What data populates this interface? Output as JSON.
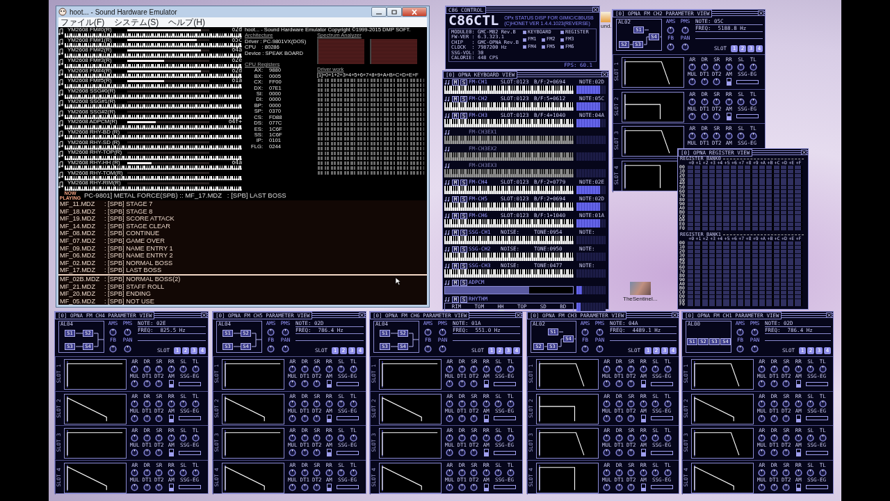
{
  "hoot": {
    "title": "hoot... - Sound Hardware Emulator",
    "menu": [
      {
        "label": "ファイル(F)"
      },
      {
        "label": "システム(S)"
      },
      {
        "label": "ヘルプ(H)"
      }
    ],
    "channels": [
      {
        "label": "YM2608 FM#0(R)",
        "note": "o2d",
        "level": 0.9
      },
      {
        "label": "YM2608 FM#1(R)",
        "note": "o5c",
        "level": 0.85
      },
      {
        "label": "YM2608 FM#2(R)",
        "note": "o4a",
        "level": 0.9
      },
      {
        "label": "YM2608 FM#3(R)",
        "note": "o2e",
        "level": 0.45
      },
      {
        "label": "YM2608 FM#4(R)",
        "note": "o2d",
        "level": 0.9
      },
      {
        "label": "YM2608 FM#5(R)",
        "note": "o1a",
        "level": 0.45
      },
      {
        "label": "YM2608 SSG#0(R)",
        "level": 0
      },
      {
        "label": "YM2608 SSG#1(R)",
        "level": 0
      },
      {
        "label": "YM2608 SSG#2(R)",
        "level": 0
      },
      {
        "label": "YM2608 ADPCM(R)",
        "note": "o4f+",
        "level": 0.35
      },
      {
        "label": "YM2608 RHY-BD (R)",
        "level": 0
      },
      {
        "label": "YM2608 RHY-SD (R)",
        "level": 0
      },
      {
        "label": "YM2608 RHY-TOP(R)",
        "level": 0
      },
      {
        "label": "YM2608 RHY-HH (R)",
        "note": "o4a",
        "level": 0.3
      },
      {
        "label": "YM2608 RHY-TOM(R)",
        "level": 0
      },
      {
        "label": "YM2608 RHY-RIM(R)",
        "level": 0
      }
    ],
    "copyright": "hoot... - Sound Hardware Emulator Copyright ©1999-2015 DMP SOFT.",
    "architecture": {
      "heading": "Architecture",
      "lines": [
        "Driver : PC-9801VX(DOS)",
        "CPU    : 80286",
        "Device : SPEAK BOARD"
      ]
    },
    "registers": {
      "heading": "CPU Registers",
      "items": [
        {
          "name": "AX:",
          "value": "9880"
        },
        {
          "name": "BX:",
          "value": "0005"
        },
        {
          "name": "CX:",
          "value": "FF00"
        },
        {
          "name": "DX:",
          "value": "07E1"
        },
        {
          "name": "SI:",
          "value": "0000"
        },
        {
          "name": "DI:",
          "value": "0000"
        },
        {
          "name": "BP:",
          "value": "0000"
        },
        {
          "name": "SP:",
          "value": "0370"
        },
        {
          "name": "CS:",
          "value": "FD88"
        },
        {
          "name": "DS:",
          "value": "077C"
        },
        {
          "name": "ES:",
          "value": "1C6F"
        },
        {
          "name": "SS:",
          "value": "1C6F"
        },
        {
          "name": "IP:",
          "value": "0101"
        },
        {
          "name": "FLG:",
          "value": "0244"
        }
      ]
    },
    "spectrum": {
      "heading": "Spectrum Analyzer"
    },
    "driver_work": {
      "heading": "Driver work",
      "header": "[1]+0+1+2+3+4+5+6+7+8+9+A+B+C+D+E+F"
    },
    "playlist": {
      "now_playing": "NOW PLAYING",
      "header": "PC-9801] METAL FORCE(SPB) :: MF_17.MDZ   : [SPB] LAST BOSS",
      "items": [
        {
          "file": "MF_11.MDZ",
          "title": ": [SPB] STAGE 7",
          "selected": false
        },
        {
          "file": "MF_18.MDZ",
          "title": ": [SPB] STAGE 8",
          "selected": false
        },
        {
          "file": "MF_19.MDZ",
          "title": ": [SPB] SCORE ATTACK",
          "selected": false
        },
        {
          "file": "MF_14.MDZ",
          "title": ": [SPB] STAGE CLEAR",
          "selected": false
        },
        {
          "file": "MF_08.MDZ",
          "title": ": [SPB] CONTINUE",
          "selected": false
        },
        {
          "file": "MF_07.MDZ",
          "title": ": [SPB] GAME OVER",
          "selected": false
        },
        {
          "file": "MF_09.MDZ",
          "title": ": [SPB] NAME ENTRY 1",
          "selected": false
        },
        {
          "file": "MF_06.MDZ",
          "title": ": [SPB] NAME ENTRY 2",
          "selected": false
        },
        {
          "file": "MF_02.MDZ",
          "title": ": [SPB] NORMAL BOSS",
          "selected": false
        },
        {
          "file": "MF_17.MDZ",
          "title": ": [SPB] LAST BOSS",
          "selected": true
        },
        {
          "file": "MF_02B.MDZ",
          "title": ": [SPB] NORMAL BOSS(2)",
          "selected": false
        },
        {
          "file": "MF_21.MDZ",
          "title": ": [SPB] STAFF ROLL",
          "selected": false
        },
        {
          "file": "MF_20.MDZ",
          "title": ": [SPB] ENDING",
          "selected": false
        },
        {
          "file": "MF_05.MDZ",
          "title": ": [SPB] NOT USE",
          "selected": false
        }
      ]
    }
  },
  "c86_control": {
    "title": "C86 CONTROL",
    "logo": "C86CTL",
    "subtitle": [
      "OPx STATUS DISP FOR GIMIC/C86USB",
      "(C)HONET VER 1.4.4.1023(REVERSE)"
    ],
    "info": [
      "MODULE0: GMC-MB2 Rev.B",
      "FW-VER : 6.3.323.1",
      "CHIP   : GMC-OPNA Rev.B",
      "CLOCK  : 7987200 Hz",
      "SSG-VOL: 30",
      "CALORIE: 448 CPS"
    ],
    "options": [
      {
        "label": "KEYBOARD",
        "checked": true
      },
      {
        "label": "REGISTER",
        "checked": true
      },
      {
        "label": "FM1",
        "checked": true
      },
      {
        "label": "FM2",
        "checked": true
      },
      {
        "label": "FM3",
        "checked": true
      },
      {
        "label": "FM4",
        "checked": true
      },
      {
        "label": "FM5",
        "checked": true
      },
      {
        "label": "FM6",
        "checked": true
      }
    ],
    "fps": "FPS: 60.1"
  },
  "keyboard_view": {
    "title": "[0] OPNA KEYBOARD VIEW",
    "rows": [
      {
        "kind": "fm",
        "name": "FM-CH1",
        "mute": "M",
        "solo": "S",
        "field1": "SLOT:0123",
        "field2": "B/F:2+0694",
        "note": "NOTE:02D",
        "meter": {
          "level": 0.8
        }
      },
      {
        "kind": "fm",
        "name": "FM-CH2",
        "mute": "M",
        "solo": "S",
        "field1": "SLOT:0123",
        "field2": "B/F:5+0612",
        "note": "NOTE:05C",
        "meter": {
          "level": 0.8
        }
      },
      {
        "kind": "fm",
        "name": "FM-CH3",
        "mute": "M",
        "solo": "S",
        "field1": "SLOT:0123",
        "field2": "B/F:4+1040",
        "note": "NOTE:04A",
        "meter": {
          "level": 0.8
        }
      },
      {
        "kind": "ex",
        "name": "FM-CH3EX1",
        "meter": {
          "level": 0
        }
      },
      {
        "kind": "ex",
        "name": "FM-CH3EX2",
        "meter": {
          "level": 0
        }
      },
      {
        "kind": "ex",
        "name": "FM-CH3EX3",
        "meter": {
          "level": 0
        }
      },
      {
        "kind": "fm",
        "name": "FM-CH4",
        "mute": "M",
        "solo": "S",
        "field1": "SLOT:0123",
        "field2": "B/F:2+0779",
        "note": "NOTE:02E",
        "meter": {
          "level": 0.8
        }
      },
      {
        "kind": "fm",
        "name": "FM-CH5",
        "mute": "M",
        "solo": "S",
        "field1": "SLOT:0123",
        "field2": "B/F:2+0694",
        "note": "NOTE:02D",
        "meter": {
          "level": 0.8
        }
      },
      {
        "kind": "fm",
        "name": "FM-CH6",
        "mute": "M",
        "solo": "S",
        "field1": "SLOT:0123",
        "field2": "B/F:1+1040",
        "note": "NOTE:01A",
        "meter": {
          "level": 0.8
        }
      },
      {
        "kind": "ssg",
        "name": "SSG-CH1",
        "mute": "M",
        "solo": "S",
        "field1": "NOISE:",
        "field2": "TONE:0954",
        "note": "NOTE:",
        "meter": {
          "level": 0
        }
      },
      {
        "kind": "ssg",
        "name": "SSG-CH2",
        "mute": "M",
        "solo": "S",
        "field1": "NOISE:",
        "field2": "TONE:0950",
        "note": "NOTE:",
        "meter": {
          "level": 0
        }
      },
      {
        "kind": "ssg",
        "name": "SSG-CH3",
        "mute": "M",
        "solo": "S",
        "field1": "NOISE:",
        "field2": "TONE:0477",
        "note": "NOTE:",
        "meter": {
          "level": 0
        }
      },
      {
        "kind": "adpcm",
        "name": "ADPCM",
        "mute": "M",
        "solo": "S",
        "bar": {
          "level": 0.66
        },
        "meter": {
          "level": 0.2
        }
      },
      {
        "kind": "rhythm",
        "name": "RHYTHM",
        "mute": "M",
        "solo": "S",
        "drums": [
          {
            "label": "RIM",
            "on": false
          },
          {
            "label": "TOM",
            "on": false
          },
          {
            "label": "HH",
            "on": true
          },
          {
            "label": "TOP",
            "on": false
          },
          {
            "label": "SD",
            "on": false
          },
          {
            "label": "BD",
            "on": false
          }
        ],
        "meter": {
          "level": 0.15
        }
      }
    ]
  },
  "param_views": [
    {
      "title": "[0] OPNA FM CH2 PARAMETER VIEW",
      "algorithm": {
        "kind": "alg2",
        "label": "AL02",
        "ops": [
          "S1",
          "S2",
          "S3",
          "S4"
        ]
      },
      "top_knobs": [
        "AMS",
        "PMS",
        "FB",
        "PAN"
      ],
      "note": "NOTE: 05C",
      "freq_label": "FREQ:",
      "freq": "5188.8 Hz",
      "slot_label": "SLOT",
      "slot_buttons": [
        {
          "label": "1",
          "on": true
        },
        {
          "label": "2",
          "on": true
        },
        {
          "label": "3",
          "on": true
        },
        {
          "label": "4",
          "on": true
        }
      ],
      "slot_panels": [
        {
          "label": "SLOT 1",
          "envelope": {
            "kind": "drop"
          },
          "knobs": [
            "AR",
            "DR",
            "SR",
            "RR",
            "SL",
            "TL"
          ],
          "knobs2": [
            "MUL",
            "DT1",
            "DT2"
          ],
          "am_label": "AM",
          "am": {
            "on": true
          },
          "ssg": "SSG-EG"
        },
        {
          "label": "SLOT 2",
          "envelope": {
            "kind": "step"
          },
          "knobs": [
            "AR",
            "DR",
            "SR",
            "RR",
            "SL",
            "TL"
          ],
          "knobs2": [
            "MUL",
            "DT1",
            "DT2"
          ],
          "am_label": "AM",
          "am": {
            "on": true
          },
          "ssg": "SSG-EG"
        },
        {
          "label": "SLOT 3",
          "envelope": {
            "kind": "drop"
          },
          "knobs": [
            "AR",
            "DR",
            "SR",
            "RR",
            "SL",
            "TL"
          ],
          "knobs2": [
            "MUL",
            "DT1",
            "DT2"
          ],
          "am_label": "AM",
          "ssg": "SSG-EG"
        },
        {
          "label": "SLOT 4",
          "envelope": {
            "kind": "highstep"
          }
        }
      ]
    },
    {
      "title": "[0] OPNA FM CH4 PARAMETER VIEW",
      "algorithm": {
        "kind": "alg4",
        "label": "AL04",
        "ops": [
          "S1",
          "S2",
          "S3",
          "S4"
        ]
      },
      "top_knobs": [
        "AMS",
        "PMS",
        "FB",
        "PAN"
      ],
      "note": "NOTE: 02E",
      "freq_label": "FREQ:",
      "freq": "825.5 Hz",
      "slot_label": "SLOT",
      "slot_buttons": [
        {
          "label": "1",
          "on": true
        },
        {
          "label": "2",
          "on": true
        },
        {
          "label": "3",
          "on": true
        },
        {
          "label": "4",
          "on": true
        }
      ],
      "slot_panels": [
        {
          "label": "SLOT 1",
          "envelope": {
            "kind": "flat"
          },
          "knobs": [
            "AR",
            "DR",
            "SR",
            "RR",
            "SL",
            "TL"
          ],
          "knobs2": [
            "MUL",
            "DT1",
            "DT2"
          ],
          "am_label": "AM",
          "am": {
            "on": true
          },
          "ssg": "SSG-EG"
        },
        {
          "label": "SLOT 2",
          "envelope": {
            "kind": "ramp"
          },
          "knobs": [
            "AR",
            "DR",
            "SR",
            "RR",
            "SL",
            "TL"
          ],
          "knobs2": [
            "MUL",
            "DT1",
            "DT2"
          ],
          "am_label": "AM",
          "am": {
            "on": true
          },
          "ssg": "SSG-EG"
        },
        {
          "label": "SLOT 3",
          "envelope": {
            "kind": "flat"
          },
          "knobs": [
            "AR",
            "DR",
            "SR",
            "RR",
            "SL",
            "TL"
          ],
          "knobs2": [
            "MUL",
            "DT1",
            "DT2"
          ],
          "am_label": "AM",
          "am": {
            "on": true
          },
          "ssg": "SSG-EG"
        },
        {
          "label": "SLOT 4",
          "envelope": {
            "kind": "ramp"
          },
          "knobs": [
            "AR",
            "DR",
            "SR",
            "RR",
            "SL",
            "TL"
          ],
          "knobs2": [
            "MUL",
            "DT1",
            "DT2"
          ],
          "am_label": "AM",
          "am": {
            "on": true
          },
          "ssg": "SSG-EG"
        }
      ]
    },
    {
      "title": "[0] OPNA FM CH5 PARAMETER VIEW",
      "algorithm": {
        "kind": "alg4",
        "label": "AL04",
        "ops": [
          "S1",
          "S2",
          "S3",
          "S4"
        ]
      },
      "top_knobs": [
        "AMS",
        "PMS",
        "FB",
        "PAN"
      ],
      "note": "NOTE: 02D",
      "freq_label": "FREQ:",
      "freq": "786.4 Hz",
      "slot_label": "SLOT",
      "slot_buttons": [
        {
          "label": "1",
          "on": true
        },
        {
          "label": "2",
          "on": true
        },
        {
          "label": "3",
          "on": true
        },
        {
          "label": "4",
          "on": true
        }
      ],
      "slot_panels": [
        {
          "label": "SLOT 1",
          "envelope": {
            "kind": "flat"
          },
          "knobs": [
            "AR",
            "DR",
            "SR",
            "RR",
            "SL",
            "TL"
          ],
          "knobs2": [
            "MUL",
            "DT1",
            "DT2"
          ],
          "am_label": "AM",
          "am": {
            "on": true
          },
          "ssg": "SSG-EG"
        },
        {
          "label": "SLOT 2",
          "envelope": {
            "kind": "ramp"
          },
          "knobs": [
            "AR",
            "DR",
            "SR",
            "RR",
            "SL",
            "TL"
          ],
          "knobs2": [
            "MUL",
            "DT1",
            "DT2"
          ],
          "am_label": "AM",
          "am": {
            "on": true
          },
          "ssg": "SSG-EG"
        },
        {
          "label": "SLOT 3",
          "envelope": {
            "kind": "flat"
          },
          "knobs": [
            "AR",
            "DR",
            "SR",
            "RR",
            "SL",
            "TL"
          ],
          "knobs2": [
            "MUL",
            "DT1",
            "DT2"
          ],
          "am_label": "AM",
          "am": {
            "on": true
          },
          "ssg": "SSG-EG"
        },
        {
          "label": "SLOT 4",
          "envelope": {
            "kind": "ramp"
          },
          "knobs": [
            "AR",
            "DR",
            "SR",
            "RR",
            "SL",
            "TL"
          ],
          "knobs2": [
            "MUL",
            "DT1",
            "DT2"
          ],
          "am_label": "AM",
          "am": {
            "on": true
          },
          "ssg": "SSG-EG"
        }
      ]
    },
    {
      "title": "[0] OPNA FM CH6 PARAMETER VIEW",
      "algorithm": {
        "kind": "alg4",
        "label": "AL04",
        "ops": [
          "S1",
          "S2",
          "S3",
          "S4"
        ]
      },
      "top_knobs": [
        "AMS",
        "PMS",
        "FB",
        "PAN"
      ],
      "note": "NOTE: 01A",
      "freq_label": "FREQ:",
      "freq": "551.0 Hz",
      "slot_label": "SLOT",
      "slot_buttons": [
        {
          "label": "1",
          "on": true
        },
        {
          "label": "2",
          "on": true
        },
        {
          "label": "3",
          "on": true
        },
        {
          "label": "4",
          "on": true
        }
      ],
      "slot_panels": [
        {
          "label": "SLOT 1",
          "envelope": {
            "kind": "flat"
          },
          "knobs": [
            "AR",
            "DR",
            "SR",
            "RR",
            "SL",
            "TL"
          ],
          "knobs2": [
            "MUL",
            "DT1",
            "DT2"
          ],
          "am_label": "AM",
          "am": {
            "on": true
          },
          "ssg": "SSG-EG"
        },
        {
          "label": "SLOT 2",
          "envelope": {
            "kind": "ramp"
          },
          "knobs": [
            "AR",
            "DR",
            "SR",
            "RR",
            "SL",
            "TL"
          ],
          "knobs2": [
            "MUL",
            "DT1",
            "DT2"
          ],
          "am_label": "AM",
          "am": {
            "on": true
          },
          "ssg": "SSG-EG"
        },
        {
          "label": "SLOT 3",
          "envelope": {
            "kind": "flat"
          },
          "knobs": [
            "AR",
            "DR",
            "SR",
            "RR",
            "SL",
            "TL"
          ],
          "knobs2": [
            "MUL",
            "DT1",
            "DT2"
          ],
          "am_label": "AM",
          "am": {
            "on": true
          },
          "ssg": "SSG-EG"
        },
        {
          "label": "SLOT 4",
          "envelope": {
            "kind": "ramp"
          },
          "knobs": [
            "AR",
            "DR",
            "SR",
            "RR",
            "SL",
            "TL"
          ],
          "knobs2": [
            "MUL",
            "DT1",
            "DT2"
          ],
          "am_label": "AM",
          "am": {
            "on": true
          },
          "ssg": "SSG-EG"
        }
      ]
    },
    {
      "title": "[0] OPNA FM CH3 PARAMETER VIEW",
      "algorithm": {
        "kind": "alg2",
        "label": "AL02",
        "ops": [
          "S1",
          "S2",
          "S3",
          "S4"
        ]
      },
      "top_knobs": [
        "AMS",
        "PMS",
        "FB",
        "PAN"
      ],
      "note": "NOTE: 04A",
      "freq_label": "FREQ:",
      "freq": "4489.1 Hz",
      "slot_label": "SLOT",
      "slot_buttons": [
        {
          "label": "1",
          "on": true
        },
        {
          "label": "2",
          "on": true
        },
        {
          "label": "3",
          "on": true
        },
        {
          "label": "4",
          "on": true
        }
      ],
      "slot_panels": [
        {
          "label": "SLOT 1",
          "envelope": {
            "kind": "drop"
          },
          "knobs": [
            "AR",
            "DR",
            "SR",
            "RR",
            "SL",
            "TL"
          ],
          "knobs2": [
            "MUL",
            "DT1",
            "DT2"
          ],
          "am_label": "AM",
          "am": {
            "on": true
          },
          "ssg": "SSG-EG"
        },
        {
          "label": "SLOT 2",
          "envelope": {
            "kind": "step"
          },
          "knobs": [
            "AR",
            "DR",
            "SR",
            "RR",
            "SL",
            "TL"
          ],
          "knobs2": [
            "MUL",
            "DT1",
            "DT2"
          ],
          "am_label": "AM",
          "am": {
            "on": true
          },
          "ssg": "SSG-EG"
        },
        {
          "label": "SLOT 3",
          "envelope": {
            "kind": "drop"
          },
          "knobs": [
            "AR",
            "DR",
            "SR",
            "RR",
            "SL",
            "TL"
          ],
          "knobs2": [
            "MUL",
            "DT1",
            "DT2"
          ],
          "am_label": "AM",
          "am": {
            "on": true
          },
          "ssg": "SSG-EG"
        },
        {
          "label": "SLOT 4",
          "envelope": {
            "kind": "highstep"
          },
          "knobs": [
            "AR",
            "DR",
            "SR",
            "RR",
            "SL",
            "TL"
          ],
          "knobs2": [
            "MUL",
            "DT1",
            "DT2"
          ],
          "am_label": "AM",
          "am": {
            "on": true
          },
          "ssg": "SSG-EG"
        }
      ]
    },
    {
      "title": "[0] OPNA FM CH1 PARAMETER VIEW",
      "algorithm": {
        "kind": "alg0",
        "label": "AL00",
        "ops": [
          "S1",
          "S2",
          "S3",
          "S4"
        ]
      },
      "top_knobs": [
        "AMS",
        "PMS",
        "FB",
        "PAN"
      ],
      "note": "NOTE: 02D",
      "freq_label": "FREQ:",
      "freq": "786.4 Hz",
      "slot_label": "SLOT",
      "slot_buttons": [
        {
          "label": "1",
          "on": true
        },
        {
          "label": "2",
          "on": true
        },
        {
          "label": "3",
          "on": true
        },
        {
          "label": "4",
          "on": true
        }
      ],
      "slot_panels": [
        {
          "label": "SLOT 1",
          "envelope": {
            "kind": "drop"
          },
          "knobs": [
            "AR",
            "DR",
            "SR",
            "RR",
            "SL",
            "TL"
          ],
          "knobs2": [
            "MUL",
            "DT1",
            "DT2"
          ],
          "am_label": "AM",
          "am": {
            "on": true
          },
          "ssg": "SSG-EG"
        },
        {
          "label": "SLOT 2",
          "envelope": {
            "kind": "ramp"
          },
          "knobs": [
            "AR",
            "DR",
            "SR",
            "RR",
            "SL",
            "TL"
          ],
          "knobs2": [
            "MUL",
            "DT1",
            "DT2"
          ],
          "am_label": "AM",
          "am": {
            "on": true
          },
          "ssg": "SSG-EG"
        },
        {
          "label": "SLOT 3",
          "envelope": {
            "kind": "drop"
          },
          "knobs": [
            "AR",
            "DR",
            "SR",
            "RR",
            "SL",
            "TL"
          ],
          "knobs2": [
            "MUL",
            "DT1",
            "DT2"
          ],
          "am_label": "AM",
          "am": {
            "on": true
          },
          "ssg": "SSG-EG"
        },
        {
          "label": "SLOT 4",
          "envelope": {
            "kind": "ramp"
          },
          "knobs": [
            "AR",
            "DR",
            "SR",
            "RR",
            "SL",
            "TL"
          ],
          "knobs2": [
            "MUL",
            "DT1",
            "DT2"
          ],
          "am_label": "AM",
          "am": {
            "on": true
          },
          "ssg": "SSG-EG"
        }
      ]
    }
  ],
  "register_view": {
    "title": "[0] OPNA REGISTER VIEW",
    "banks": [
      {
        "label": "REGISTER BANK0",
        "columns": [
          "+0",
          "+1",
          "+2",
          "+3",
          "+4",
          "+5",
          "+6",
          "+7",
          "+8",
          "+9",
          "+A",
          "+B",
          "+C",
          "+D",
          "+E",
          "+F"
        ],
        "rows": [
          "00",
          "10",
          "20",
          "30",
          "40",
          "50",
          "60",
          "70",
          "80",
          "90",
          "A0",
          "B0",
          "C0",
          "D0",
          "E0",
          "F0"
        ]
      },
      {
        "label": "REGISTER BANK1",
        "columns": [
          "+0",
          "+1",
          "+2",
          "+3",
          "+4",
          "+5",
          "+6",
          "+7",
          "+8",
          "+9",
          "+A",
          "+B",
          "+C",
          "+D",
          "+E",
          "+F"
        ],
        "rows": [
          "00",
          "10",
          "20",
          "30",
          "40",
          "50",
          "60",
          "70",
          "80",
          "90",
          "A0",
          "B0",
          "C0",
          "D0",
          "E0",
          "F0"
        ]
      }
    ]
  },
  "desktop_icons": [
    {
      "label": "und."
    },
    {
      "label": "TheSentinel..."
    }
  ]
}
